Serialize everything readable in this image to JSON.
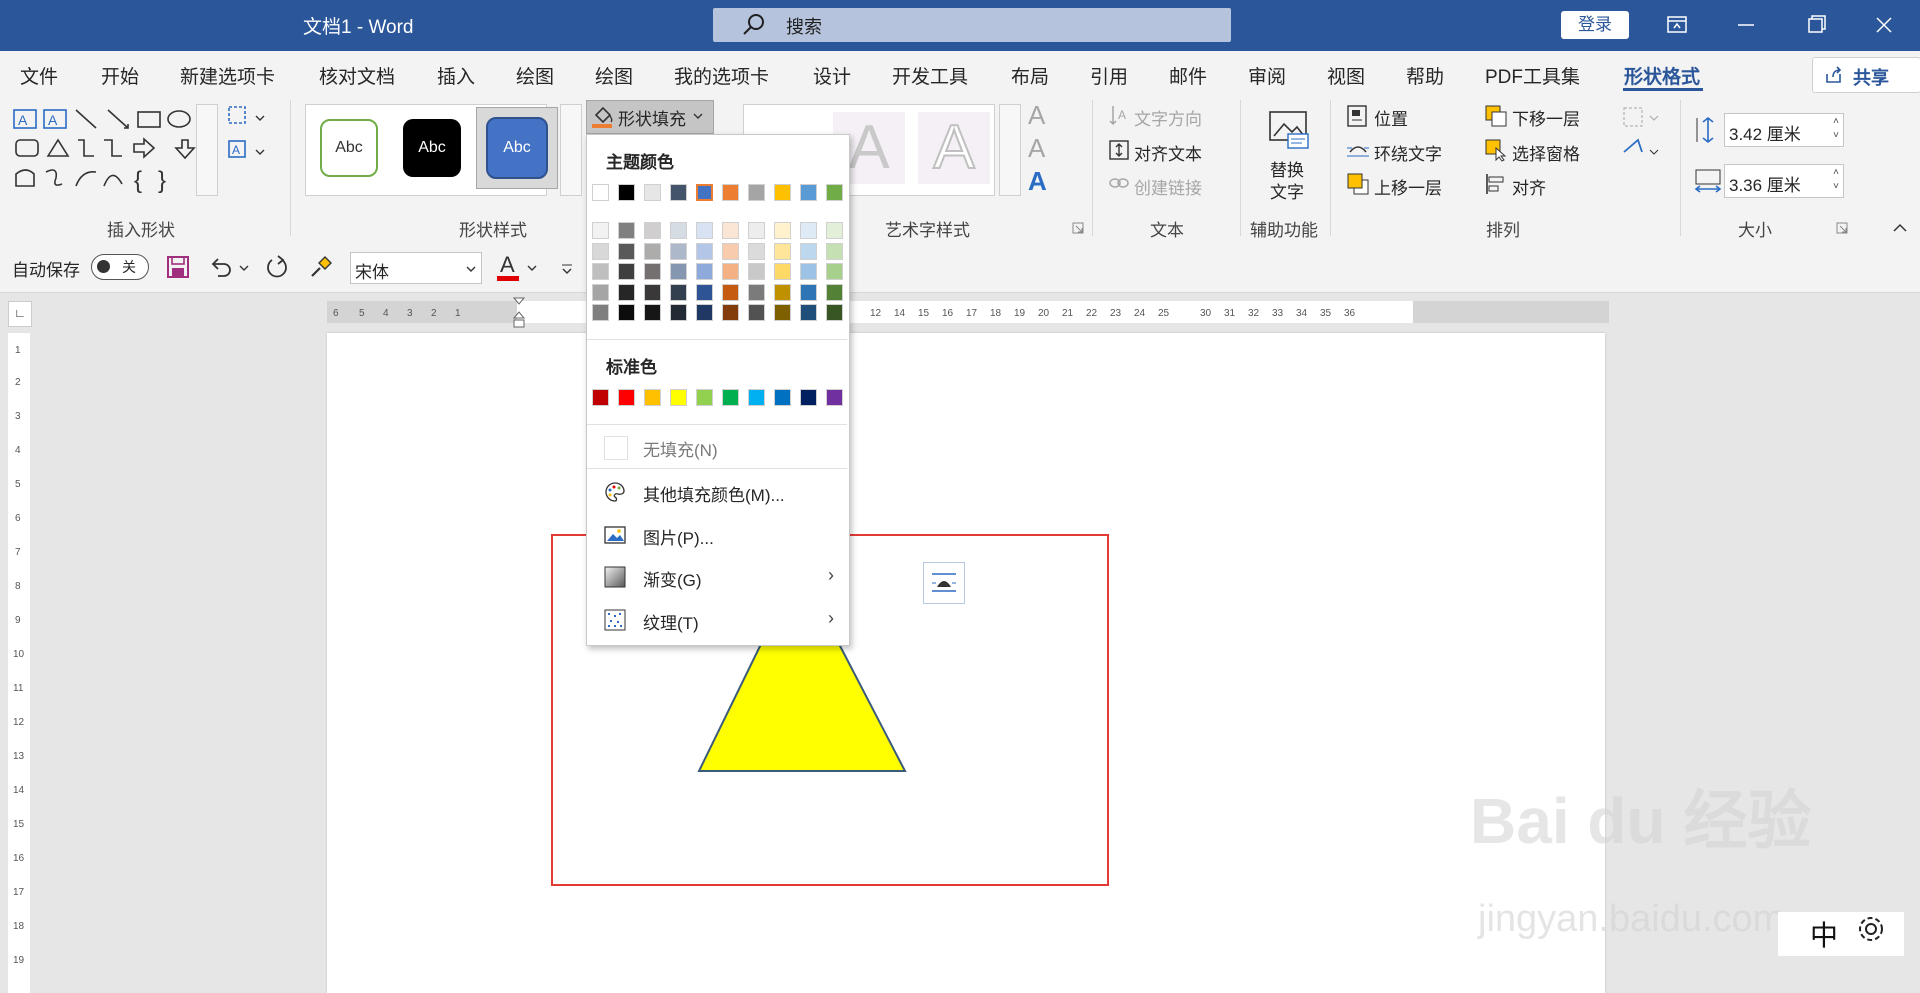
{
  "window": {
    "doc_title": "文档1  -  Word",
    "search_placeholder": "搜索",
    "login": "登录"
  },
  "tabs": [
    "文件",
    "开始",
    "新建选项卡",
    "核对文档",
    "插入",
    "绘图",
    "绘图",
    "我的选项卡",
    "设计",
    "开发工具",
    "布局",
    "引用",
    "邮件",
    "审阅",
    "视图",
    "帮助",
    "PDF工具集",
    "形状格式"
  ],
  "share": "共享",
  "ribbon": {
    "groups": {
      "insert_shape": "插入形状",
      "shape_styles": "形状样式",
      "wordart": "艺术字样式",
      "text": "文本",
      "accessibility": "辅助功能",
      "arrange": "排列",
      "size": "大小"
    },
    "style_samples": [
      "Abc",
      "Abc",
      "Abc"
    ],
    "shape_fill": "形状填充",
    "text_direction": "文字方向",
    "align_text": "对齐文本",
    "create_link": "创建链接",
    "alt_text_1": "替换",
    "alt_text_2": "文字",
    "position": "位置",
    "wrap_text": "环绕文字",
    "bring_forward": "上移一层",
    "send_backward": "下移一层",
    "selection_pane": "选择窗格",
    "align": "对齐",
    "height": "3.42 厘米",
    "width": "3.36 厘米"
  },
  "qat": {
    "autosave": "自动保存",
    "autosave_state": "关",
    "font": "宋体"
  },
  "dropdown": {
    "theme_colors_title": "主题颜色",
    "standard_colors_title": "标准色",
    "no_fill": "无填充(N)",
    "more_colors": "其他填充颜色(M)...",
    "picture": "图片(P)...",
    "gradient": "渐变(G)",
    "texture": "纹理(T)",
    "theme_top": [
      "#ffffff",
      "#000000",
      "#e7e6e6",
      "#44546a",
      "#4472c4",
      "#ed7d31",
      "#a5a5a5",
      "#ffc000",
      "#5b9bd5",
      "#70ad47"
    ],
    "theme_shades": [
      [
        "#f2f2f2",
        "#808080",
        "#d0cece",
        "#d6dce4",
        "#d9e2f3",
        "#fbe5d5",
        "#ededed",
        "#fff2cc",
        "#deebf6",
        "#e2efd9"
      ],
      [
        "#d8d8d8",
        "#595959",
        "#aeabab",
        "#adb9ca",
        "#b4c6e7",
        "#f7cbac",
        "#dbdbdb",
        "#fee599",
        "#bdd7ee",
        "#c5e0b3"
      ],
      [
        "#bfbfbf",
        "#3f3f3f",
        "#757070",
        "#8496b0",
        "#8eaadb",
        "#f4b183",
        "#c9c9c9",
        "#ffd965",
        "#9cc3e5",
        "#a8d08d"
      ],
      [
        "#a5a5a5",
        "#262626",
        "#3a3838",
        "#323f4f",
        "#2f5496",
        "#c55a11",
        "#7b7b7b",
        "#bf9000",
        "#2e75b5",
        "#538135"
      ],
      [
        "#7f7f7f",
        "#0c0c0c",
        "#171616",
        "#222a35",
        "#1f3864",
        "#833c0b",
        "#525252",
        "#7f6000",
        "#1e4e79",
        "#375623"
      ]
    ],
    "standard": [
      "#c00000",
      "#ff0000",
      "#ffc000",
      "#ffff00",
      "#92d050",
      "#00b050",
      "#00b0f0",
      "#0070c0",
      "#002060",
      "#7030a0"
    ]
  },
  "ime": {
    "mode": "中"
  },
  "watermark": {
    "line1": "Bai du 经验",
    "line2": "jingyan.baidu.com"
  }
}
